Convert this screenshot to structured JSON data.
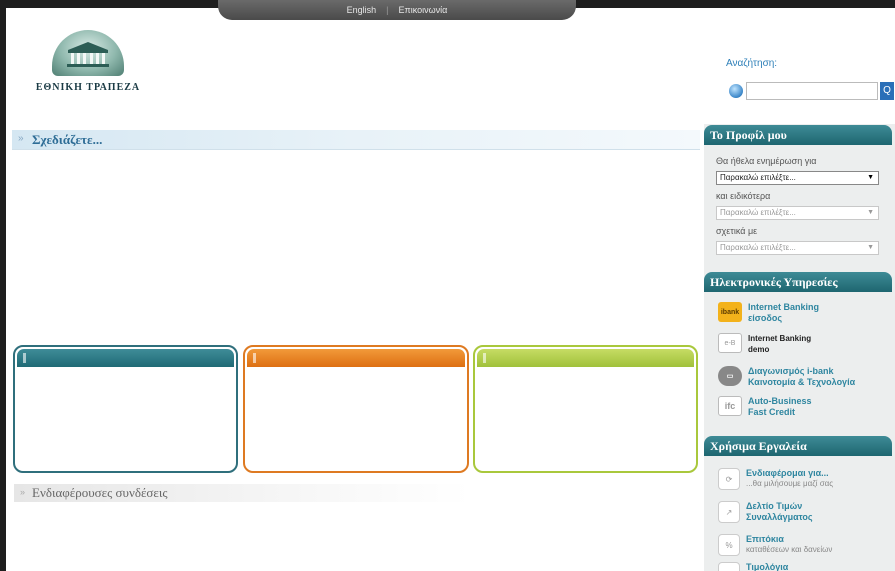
{
  "topnav": {
    "english": "English",
    "separator": "|",
    "contact": "Επικοινωνία"
  },
  "logo": {
    "name": "ΕΘΝΙΚΗ ΤΡΑΠΕΖΑ"
  },
  "search": {
    "label": "Αναζήτηση:",
    "placeholder": "",
    "button": "Q"
  },
  "main": {
    "plan_arrow": "»",
    "plan_title": "Σχεδιάζετε...",
    "links_arrow": "»",
    "links_title": "Ενδιαφέρουσες συνδέσεις"
  },
  "profile": {
    "title": "Το Προφίλ μου",
    "label1": "Θα ήθελα ενημέρωση για",
    "select1": "Παρακαλώ επιλέξτε...",
    "label2": "και ειδικότερα",
    "select2": "Παρακαλώ επιλέξτε...",
    "label3": "σχετικά με",
    "select3": "Παρακαλώ επιλέξτε..."
  },
  "services": {
    "title": "Ηλεκτρονικές Υπηρεσίες",
    "items": [
      {
        "line1": "Internet Banking",
        "line2": "είσοδος",
        "icon": "ibank"
      },
      {
        "line1": "Internet Banking",
        "line2": "demo",
        "icon": "e-B demo"
      },
      {
        "line1": "Διαγωνισμός i-bank",
        "line2": "Καινοτομία & Τεχνολογία",
        "icon": "chat"
      },
      {
        "line1": "Auto-Business",
        "line2": "Fast Credit",
        "icon": "ifc"
      }
    ]
  },
  "tools": {
    "title": "Χρήσιμα Εργαλεία",
    "items": [
      {
        "title": "Ενδιαφέρομαι για...",
        "sub": "...θα μιλήσουμε μαζί σας"
      },
      {
        "title": "Δελτίο Τιμών",
        "title2": "Συναλλάγματος"
      },
      {
        "title": "Επιτόκια",
        "sub": "καταθέσεων και δανείων"
      },
      {
        "title": "Τιμολόγια"
      }
    ]
  },
  "colors": {
    "teal": "#1f6a75",
    "orange": "#dd6f12",
    "green": "#a0c13a",
    "link": "#2f86a0"
  }
}
